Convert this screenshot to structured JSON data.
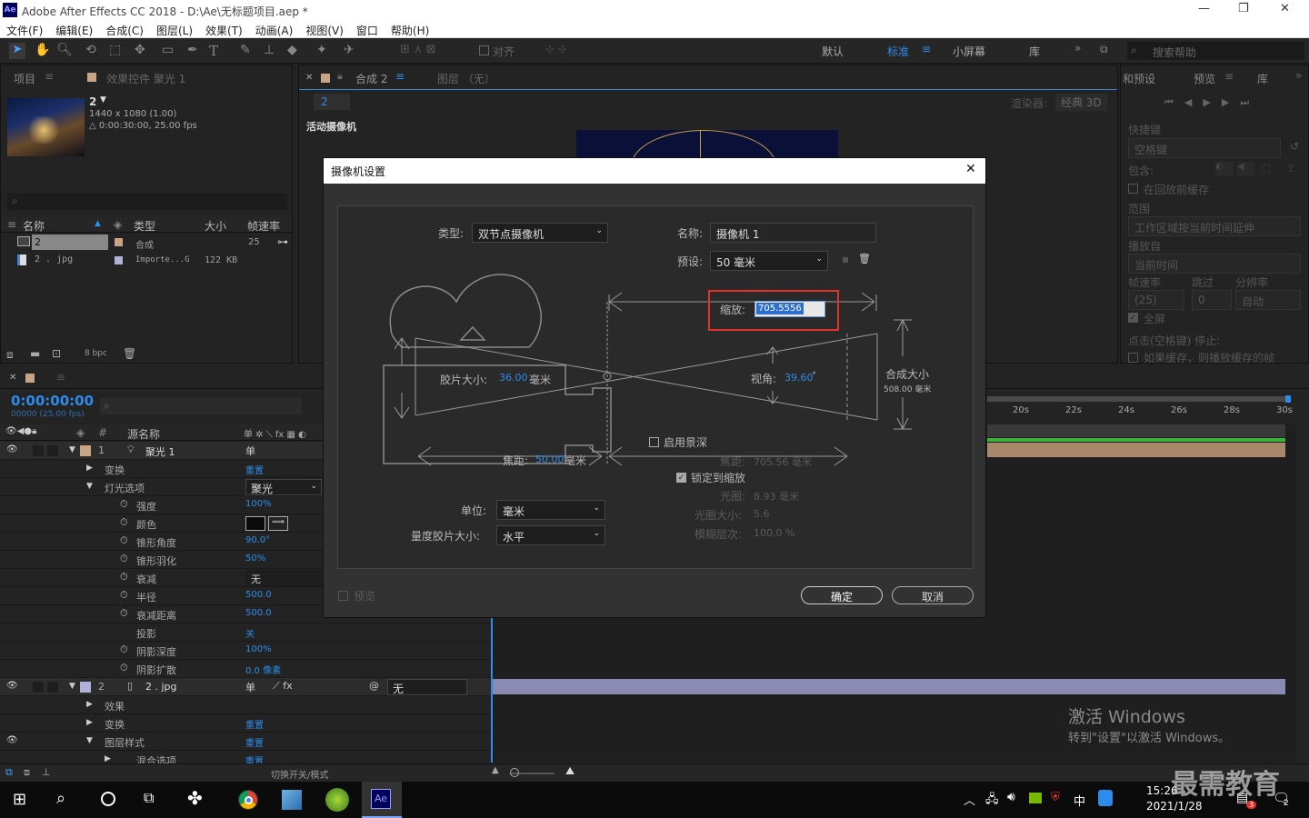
{
  "window": {
    "title": "Adobe After Effects CC 2018 - D:\\Ae\\无标题项目.aep *",
    "minimize": "—",
    "restore": "❐",
    "close": "✕"
  },
  "menu": [
    "文件(F)",
    "编辑(E)",
    "合成(C)",
    "图层(L)",
    "效果(T)",
    "动画(A)",
    "视图(V)",
    "窗口",
    "帮助(H)"
  ],
  "toolbar": {
    "snap_label": "对齐",
    "workspaces": [
      "默认",
      "标准",
      "小屏幕",
      "库"
    ],
    "search_placeholder": "搜索帮助"
  },
  "project_panel": {
    "tab_project": "项目",
    "tab_effects": "效果控件 聚光 1",
    "comp_name": "2",
    "comp_info1": "1440 x 1080 (1.00)",
    "comp_info2": "△ 0:00:30:00, 25.00 fps",
    "columns": [
      "名称",
      "类型",
      "大小",
      "帧速率"
    ],
    "items": [
      {
        "name": "2",
        "type": "合成",
        "size": "",
        "fps": "25"
      },
      {
        "name": "2 . jpg",
        "type": "Importe...G",
        "size": "122 KB",
        "fps": ""
      }
    ],
    "bpc": "8 bpc"
  },
  "comp_panel": {
    "tab": "合成 2",
    "layer_tab": "图层 （无）",
    "comp_chip": "2",
    "renderer_label": "渲染器:",
    "renderer": "经典 3D",
    "active_camera": "活动摄像机"
  },
  "preview_panel": {
    "tab_info": "和预设",
    "tab_preview": "预览",
    "tab_lib": "库",
    "shortcut_label": "快捷键",
    "shortcut_value": "空格键",
    "include_label": "包含:",
    "cache_before": "在回放前缓存",
    "range_label": "范围",
    "range_value": "工作区域按当前时间延伸",
    "play_from_label": "播放自",
    "play_from_value": "当前时间",
    "fps_label": "帧速率",
    "skip_label": "跳过",
    "res_label": "分辨率",
    "fps_value": "(25)",
    "skip_value": "0",
    "res_value": "自动",
    "fullscreen": "全屏",
    "stop_label": "点击(空格键) 停止:",
    "if_cached": "如果缓存，则播放缓存的帧"
  },
  "timeline": {
    "timecode": "0:00:00:00",
    "frame_info": "00000 (25.00 fps)",
    "col_source": "源名称",
    "ruler": [
      "20s",
      "22s",
      "24s",
      "26s",
      "28s",
      "30s"
    ],
    "layers": [
      {
        "num": "1",
        "name": "聚光 1",
        "indent": 0,
        "expand": "▼",
        "eye": true,
        "prop": "",
        "value": ""
      },
      {
        "name": "变换",
        "indent": 1,
        "expand": "▶",
        "value": "重置"
      },
      {
        "name": "灯光选项",
        "indent": 1,
        "expand": "▼",
        "value": "聚光",
        "dropdown": true
      },
      {
        "name": "强度",
        "indent": 2,
        "stopwatch": true,
        "value": "100%"
      },
      {
        "name": "颜色",
        "indent": 2,
        "stopwatch": true,
        "value": "",
        "color": true
      },
      {
        "name": "锥形角度",
        "indent": 2,
        "stopwatch": true,
        "value": "90.0°"
      },
      {
        "name": "锥形羽化",
        "indent": 2,
        "stopwatch": true,
        "value": "50%"
      },
      {
        "name": "衰减",
        "indent": 2,
        "stopwatch": true,
        "value": "无",
        "grey": true
      },
      {
        "name": "半径",
        "indent": 2,
        "stopwatch": true,
        "value": "500.0"
      },
      {
        "name": "衰减距离",
        "indent": 2,
        "stopwatch": true,
        "value": "500.0"
      },
      {
        "name": "投影",
        "indent": 2,
        "stopwatch": false,
        "value": "关"
      },
      {
        "name": "阴影深度",
        "indent": 2,
        "stopwatch": true,
        "value": "100%"
      },
      {
        "name": "阴影扩散",
        "indent": 2,
        "stopwatch": true,
        "value": "0.0 像素"
      },
      {
        "num": "2",
        "name": "2 . jpg",
        "indent": 0,
        "expand": "▼",
        "eye": true,
        "value": "无",
        "parent": true
      },
      {
        "name": "效果",
        "indent": 1,
        "expand": "▶",
        "value": ""
      },
      {
        "name": "变换",
        "indent": 1,
        "expand": "▶",
        "value": "重置"
      },
      {
        "name": "图层样式",
        "indent": 1,
        "expand": "▼",
        "value": "重置",
        "eye": true
      },
      {
        "name": "混合选项",
        "indent": 2,
        "expand": "▶",
        "value": "重置"
      }
    ],
    "switch_mode": "切换开关/模式"
  },
  "dialog": {
    "title": "摄像机设置",
    "type_label": "类型:",
    "type_value": "双节点摄像机",
    "name_label": "名称:",
    "name_value": "摄像机 1",
    "preset_label": "预设:",
    "preset_value": "50 毫米",
    "zoom_label": "缩放:",
    "zoom_value": "705.5556",
    "film_label": "胶片大小:",
    "film_value": "36.00",
    "film_unit": "毫米",
    "angle_label": "视角:",
    "angle_value": "39.60",
    "angle_unit": "°",
    "comp_size_label": "合成大小",
    "comp_size_value": "508.00 毫米",
    "dof_label": "启用景深",
    "focal_label": "焦距:",
    "focal_value": "50.00",
    "focal_unit": "毫米",
    "focus_dist_label": "焦距:",
    "focus_dist_value": "705.56 毫米",
    "lock_label": "锁定到缩放",
    "aperture_label": "光圈:",
    "aperture_value": "8.93 毫米",
    "fstop_label": "光圈大小:",
    "fstop_value": "5.6",
    "blur_label": "模糊层次:",
    "blur_value": "100.0 %",
    "units_label": "单位:",
    "units_value": "毫米",
    "measure_label": "量度胶片大小:",
    "measure_value": "水平",
    "preview_label": "预览",
    "ok": "确定",
    "cancel": "取消"
  },
  "watermark": {
    "line1": "激活 Windows",
    "line2": "转到\"设置\"以激活 Windows。",
    "brand": "最需教育"
  },
  "taskbar": {
    "time": "15:26",
    "date": "2021/1/28",
    "ime": "中",
    "notif": "2",
    "badge": "3"
  },
  "colors": {
    "accent_blue": "#2d8ceb",
    "highlight_red": "#e3312c",
    "layer_tan": "#c9a484",
    "layer_purple": "#8b8ab3"
  }
}
